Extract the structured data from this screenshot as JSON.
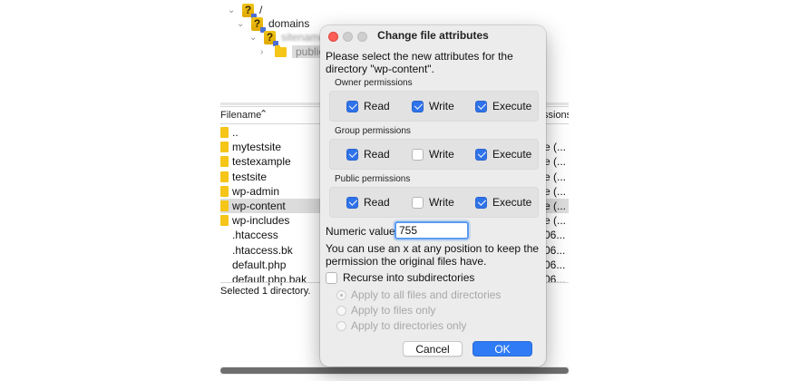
{
  "tree": {
    "root_label": "/",
    "domains_label": "domains",
    "site_label": "sitename",
    "public_label": "public_"
  },
  "file_list": {
    "header_filename": "Filename",
    "header_sort_glyph": "⌃",
    "header_permissions": "ssions",
    "rows": [
      {
        "name": "..",
        "type": "folder",
        "perm": ""
      },
      {
        "name": "mytestsite",
        "type": "folder",
        "perm": "e (..."
      },
      {
        "name": "testexample",
        "type": "folder",
        "perm": "e (..."
      },
      {
        "name": "testsite",
        "type": "folder",
        "perm": "e (..."
      },
      {
        "name": "wp-admin",
        "type": "folder",
        "perm": "e (..."
      },
      {
        "name": "wp-content",
        "type": "folder",
        "perm": "e (..."
      },
      {
        "name": "wp-includes",
        "type": "folder",
        "perm": "e (..."
      },
      {
        "name": ".htaccess",
        "type": "file",
        "perm": "06..."
      },
      {
        "name": ".htaccess.bk",
        "type": "file",
        "perm": "06..."
      },
      {
        "name": "default.php",
        "type": "file",
        "perm": "06..."
      },
      {
        "name": "default.php.bak",
        "type": "file",
        "perm": "06..."
      }
    ],
    "status": "Selected 1 directory."
  },
  "dialog": {
    "title": "Change file attributes",
    "message": "Please select the new attributes for the directory \"wp-content\".",
    "groups": [
      {
        "label": "Owner permissions",
        "read": true,
        "write": true,
        "execute": true
      },
      {
        "label": "Group permissions",
        "read": true,
        "write": false,
        "execute": true
      },
      {
        "label": "Public permissions",
        "read": true,
        "write": false,
        "execute": true
      }
    ],
    "read_label": "Read",
    "write_label": "Write",
    "execute_label": "Execute",
    "numeric_label": "Numeric value:",
    "numeric_value": "755",
    "hint": "You can use an x at any position to keep the permission the original files have.",
    "recurse_label": "Recurse into subdirectories",
    "recurse_checked": false,
    "apply_options": [
      {
        "label": "Apply to all files and directories",
        "selected": true
      },
      {
        "label": "Apply to files only",
        "selected": false
      },
      {
        "label": "Apply to directories only",
        "selected": false
      }
    ],
    "cancel_label": "Cancel",
    "ok_label": "OK"
  },
  "colors": {
    "accent": "#2f7bf5",
    "close_button": "#ff5f57",
    "folder": "#f5c518"
  }
}
